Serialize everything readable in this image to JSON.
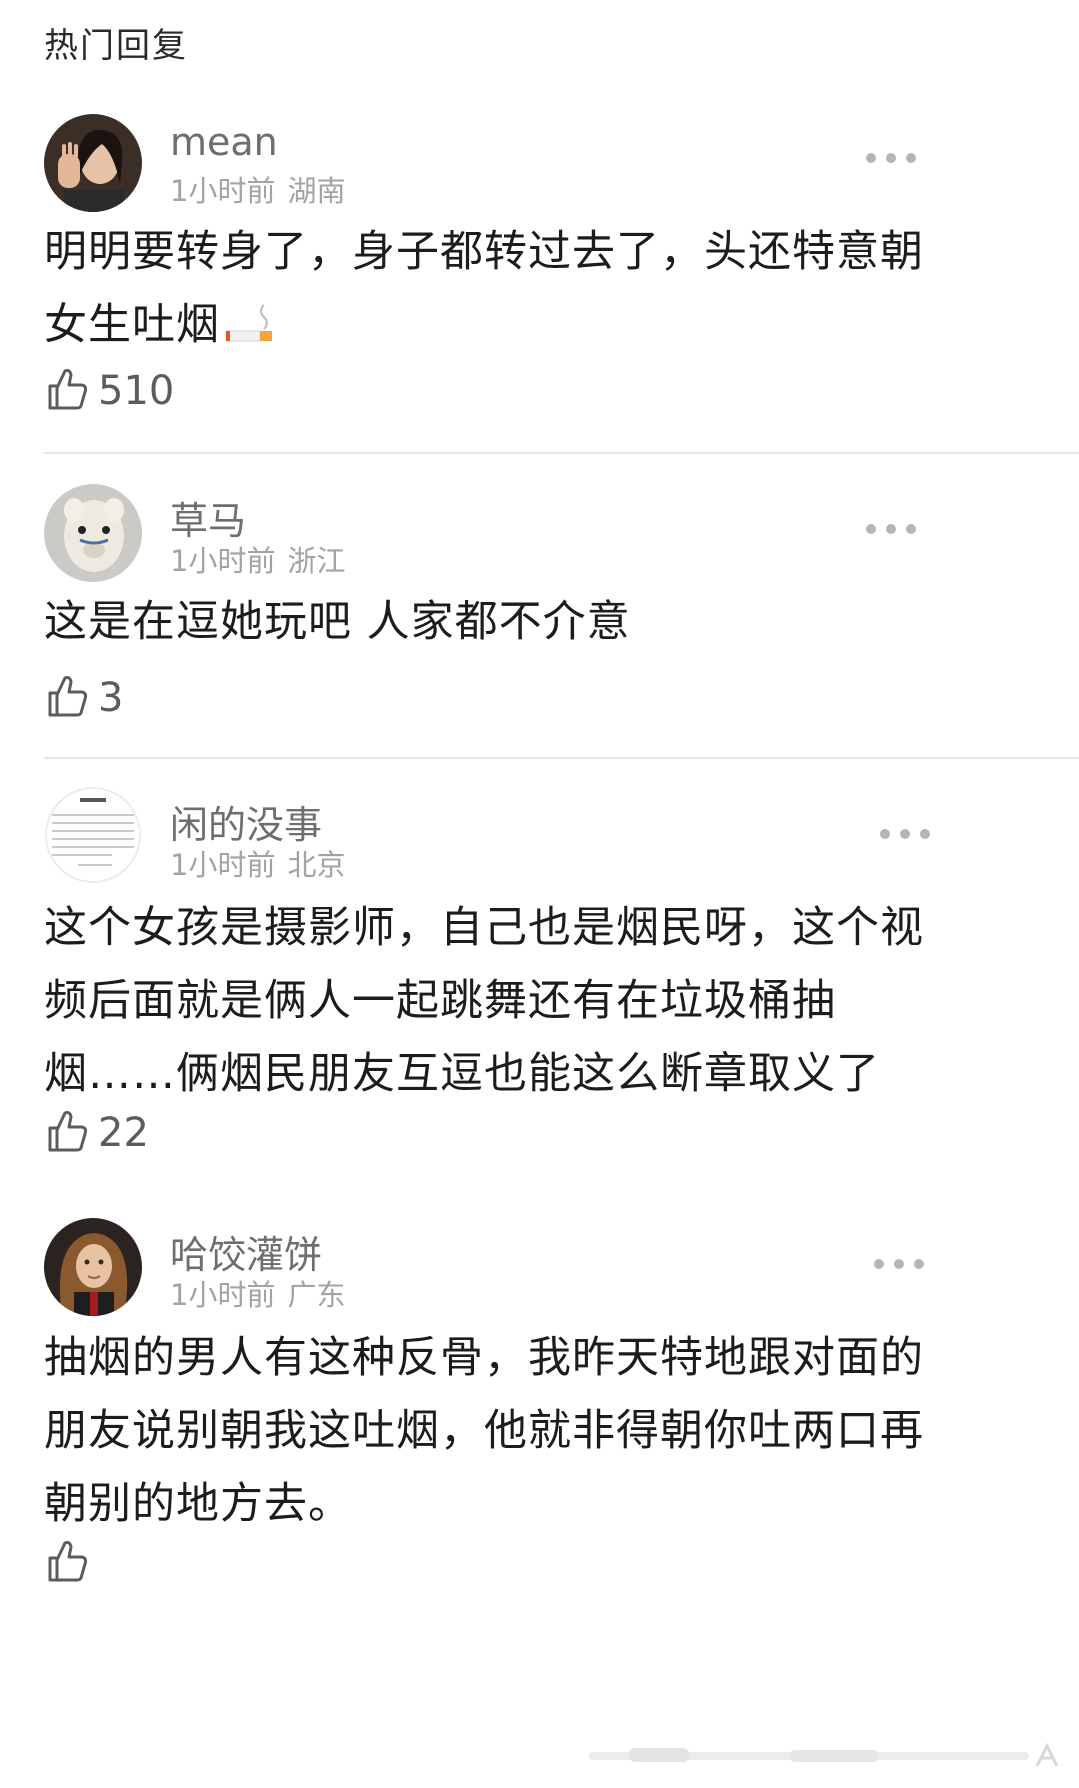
{
  "section_title": "热门回复",
  "comments": [
    {
      "username": "mean",
      "time": "1小时前",
      "location": "湖南",
      "lines": [
        "明明要转身了，身子都转过去了，头还特意朝",
        "女生吐烟"
      ],
      "emoji": "cigarette-icon",
      "likes": "510"
    },
    {
      "username": "草马",
      "time": "1小时前",
      "location": "浙江",
      "lines": [
        "这是在逗她玩吧 人家都不介意"
      ],
      "likes": "3"
    },
    {
      "username": "闲的没事",
      "time": "1小时前",
      "location": "北京",
      "lines": [
        "这个女孩是摄影师，自己也是烟民呀，这个视",
        "频后面就是俩人一起跳舞还有在垃圾桶抽",
        "烟……俩烟民朋友互逗也能这么断章取义了"
      ],
      "likes": "22"
    },
    {
      "username": "哈饺灌饼",
      "time": "1小时前",
      "location": "广东",
      "lines": [
        "抽烟的男人有这种反骨，我昨天特地跟对面的",
        "朋友说别朝我这吐烟，他就非得朝你吐两口再",
        "朝别的地方去。"
      ],
      "likes": ""
    }
  ],
  "colors": {
    "username": "#6e6e6e",
    "meta": "#a3a3a3",
    "content": "#1c1c1c",
    "divider": "#e6e6e6"
  },
  "icons": {
    "like": "thumbs-up-icon",
    "more": "more-dots-icon"
  }
}
